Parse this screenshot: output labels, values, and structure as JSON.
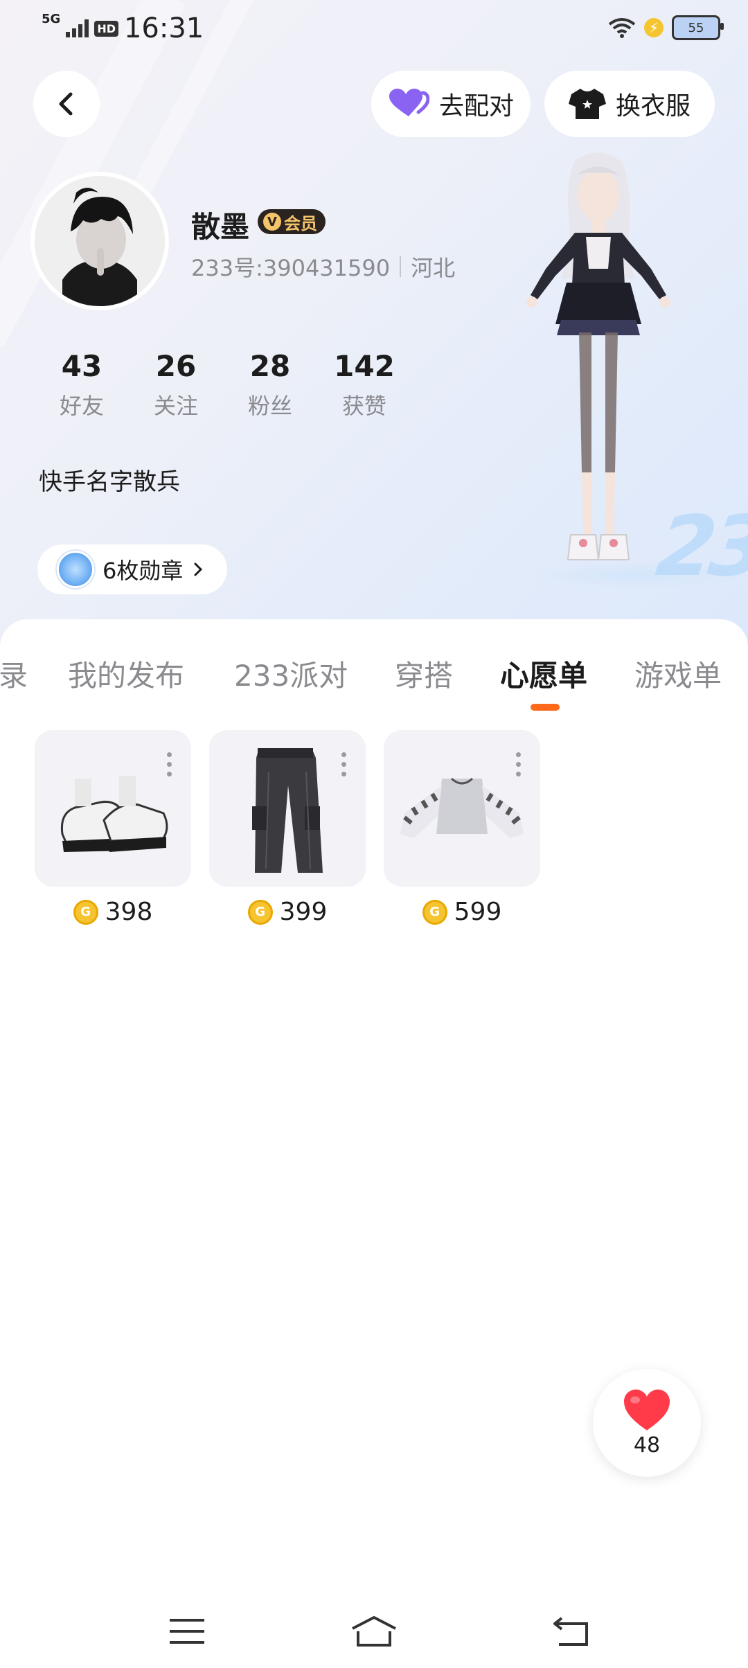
{
  "status_bar": {
    "network": "5G",
    "hd": "HD",
    "time": "16:31",
    "battery": "55"
  },
  "header": {
    "match_label": "去配对",
    "dress_label": "换衣服"
  },
  "profile": {
    "name": "散墨",
    "vip_label": "会员",
    "uid": "233号:390431590",
    "location": "河北",
    "bio": "快手名字散兵",
    "badges_label": "6枚勋章",
    "stats": [
      {
        "value": "43",
        "label": "好友"
      },
      {
        "value": "26",
        "label": "关注"
      },
      {
        "value": "28",
        "label": "粉丝"
      },
      {
        "value": "142",
        "label": "获赞"
      }
    ]
  },
  "deco_text": "233",
  "tabs": [
    {
      "label": "录",
      "active": false
    },
    {
      "label": "我的发布",
      "active": false
    },
    {
      "label": "233派对",
      "active": false
    },
    {
      "label": "穿搭",
      "active": false
    },
    {
      "label": "心愿单",
      "active": true
    },
    {
      "label": "游戏单",
      "active": false
    }
  ],
  "wishlist": [
    {
      "name": "sneakers",
      "price": "398"
    },
    {
      "name": "cargo-pants",
      "price": "399"
    },
    {
      "name": "striped-top",
      "price": "599"
    }
  ],
  "likes": {
    "count": "48"
  },
  "colors": {
    "accent": "#ff6a1a",
    "heart": "#ff3b4a",
    "vip_gold": "#f4c46a",
    "coin": "#f6c431",
    "match_heart": "#8a63f2"
  }
}
